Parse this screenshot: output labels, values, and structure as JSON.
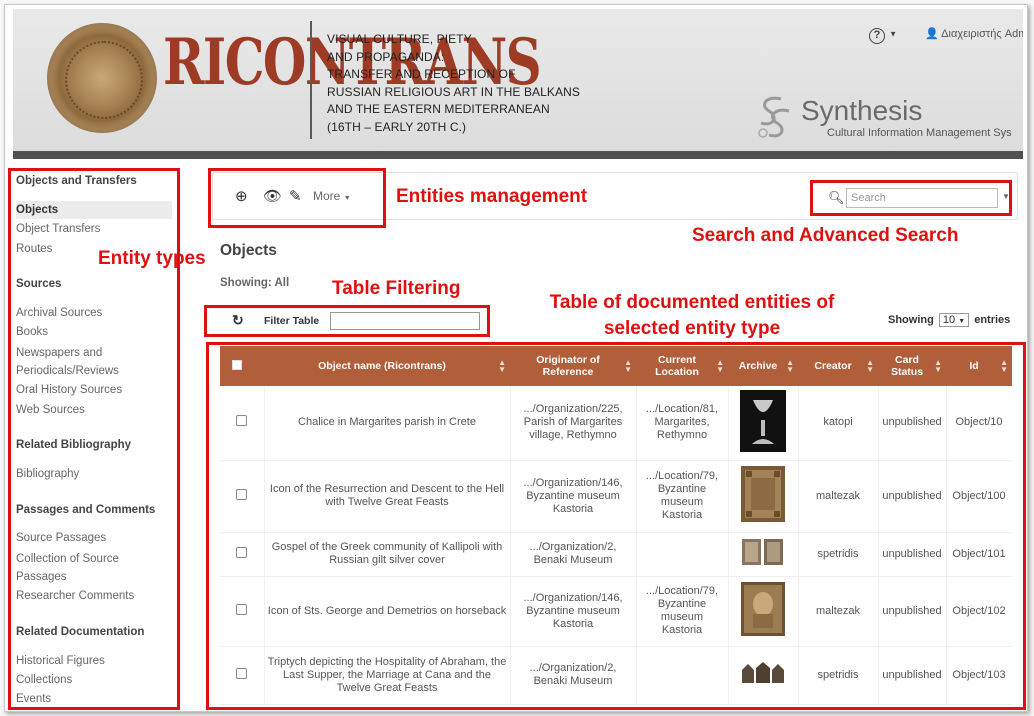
{
  "header": {
    "logo_text": "RICONTRANS",
    "project_title_lines": [
      "VISUAL CULTURE, PIETY",
      "AND PROPAGANDA:",
      "TRANSFER AND RECEPTION OF",
      "RUSSIAN RELIGIOUS ART IN THE BALKANS",
      "AND THE EASTERN MEDITERRANEAN",
      "(16TH – EARLY 20TH C.)"
    ],
    "help_label": "?",
    "user_label": "Διαχειριστής Adm",
    "synthesis_name": "Synthesis",
    "synthesis_subtitle": "Cultural Information Management Sys"
  },
  "sidebar": {
    "groups": [
      {
        "title": "Objects and Transfers",
        "items": [
          "Objects",
          "Object Transfers",
          "Routes"
        ]
      },
      {
        "title": "Sources",
        "items": [
          "Archival Sources",
          "Books",
          "Newspapers and Periodicals/Reviews",
          "Oral History Sources",
          "Web Sources"
        ]
      },
      {
        "title": "Related Bibliography",
        "items": [
          "Bibliography"
        ]
      },
      {
        "title": "Passages and Comments",
        "items": [
          "Source Passages",
          "Collection of Source Passages",
          "Researcher Comments"
        ]
      },
      {
        "title": "Related Documentation",
        "items": [
          "Historical Figures",
          "Collections",
          "Events"
        ]
      }
    ]
  },
  "toolbar": {
    "add_icon": "plus-circle-icon",
    "view_icon": "eye-icon",
    "edit_icon": "edit-icon",
    "more_label": "More"
  },
  "search": {
    "placeholder": "Search"
  },
  "main": {
    "title": "Objects",
    "showing": "Showing: All",
    "filter_label": "Filter Table",
    "entries_prefix": "Showing",
    "entries_value": "10",
    "entries_suffix": "entries"
  },
  "table": {
    "columns": [
      "Object name (Ricontrans)",
      "Originator of Reference",
      "Current Location",
      "Archive",
      "Creator",
      "Card Status",
      "Id"
    ],
    "rows": [
      {
        "name": "Chalice in Margarites parish in Crete",
        "originator": ".../Organization/225, Parish of Margarites village, Rethymno",
        "location": ".../Location/81, Margarites, Rethymno",
        "archive": "chalice-thumbnail",
        "creator": "katopi",
        "status": "unpublished",
        "id": "Object/10"
      },
      {
        "name": "Icon of the Resurrection and Descent to the Hell with Twelve Great Feasts",
        "originator": ".../Organization/146, Byzantine museum Kastoria",
        "location": ".../Location/79, Byzantine museum Kastoria",
        "archive": "icon-thumbnail",
        "creator": "maltezak",
        "status": "unpublished",
        "id": "Object/100"
      },
      {
        "name": "Gospel of the Greek community of Kallipoli with Russian gilt silver cover",
        "originator": ".../Organization/2, Benaki Museum",
        "location": "",
        "archive": "gospel-thumbnail",
        "creator": "spetridis",
        "status": "unpublished",
        "id": "Object/101"
      },
      {
        "name": "Icon of Sts. George and Demetrios on horseback",
        "originator": ".../Organization/146, Byzantine museum Kastoria",
        "location": ".../Location/79, Byzantine museum Kastoria",
        "archive": "icon-thumbnail",
        "creator": "maltezak",
        "status": "unpublished",
        "id": "Object/102"
      },
      {
        "name": "Triptych depicting the Hospitality of Abraham, the Last Supper, the Marriage at Cana and the Twelve Great Feasts",
        "originator": ".../Organization/2, Benaki Museum",
        "location": "",
        "archive": "triptych-thumbnail",
        "creator": "spetridis",
        "status": "unpublished",
        "id": "Object/103"
      }
    ]
  },
  "annotations": {
    "entity_types": "Entity types",
    "entities_management": "Entities management",
    "search_advanced": "Search and Advanced Search",
    "table_filtering": "Table Filtering",
    "table_documented": "Table of documented entities of selected entity type"
  },
  "colors": {
    "accent": "#b15e3a",
    "annotation": "#e01010",
    "header_bar": "#505050",
    "logo_red": "#9e3b24"
  }
}
